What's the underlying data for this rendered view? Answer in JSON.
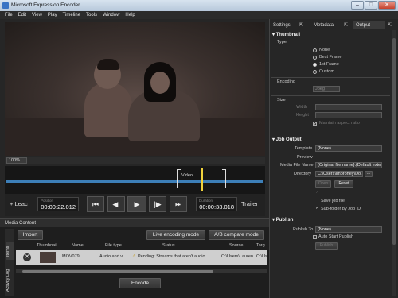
{
  "window": {
    "title": "Microsoft Expression Encoder",
    "minimize": "–",
    "maximize": "□",
    "close": "✕"
  },
  "menu": [
    "File",
    "Edit",
    "View",
    "Play",
    "Timeline",
    "Tools",
    "Window",
    "Help"
  ],
  "player": {
    "zoom": "100%",
    "lead_label": "Leac",
    "position_label": "Position",
    "position": "00:00:22.012",
    "duration_label": "Duration",
    "duration": "00:00:33.018",
    "trailer_label": "Trailer",
    "timeline_label": "Video"
  },
  "media_content": {
    "title": "Media Content",
    "import_label": "Import",
    "live_label": "Live encoding mode",
    "ab_label": "A/B compare mode",
    "side_tabs": [
      "Items",
      "Activity Log"
    ],
    "columns": [
      "Thumbnail",
      "Name",
      "File type",
      "Status",
      "Source",
      "Targ"
    ],
    "row": {
      "name": "MOV079",
      "file_type": "Audio and vi...",
      "status": "Pending: Streams that aren't audio",
      "source": "C:\\Users\\Lauren...",
      "target": "C:\\Use"
    },
    "encode_label": "Encode"
  },
  "right_panel": {
    "tabs": [
      "Settings",
      "Metadata",
      "Output"
    ],
    "thumbnail": {
      "title": "Thumbnail",
      "type_label": "Type",
      "options": [
        "None",
        "Best Frame",
        "1st Frame",
        "Custom"
      ],
      "selected": "1st Frame",
      "encoding_label": "Encoding",
      "encoding_value": "Jpeg",
      "size_label": "Size",
      "width_label": "Width",
      "height_label": "Height",
      "maintain_label": "Maintain aspect ratio"
    },
    "job_output": {
      "title": "Job Output",
      "template_label": "Template",
      "template_value": "(None)",
      "preview_label": "Preview",
      "media_file_label": "Media File Name",
      "media_file_value": "{Original file name}.{Default exten...",
      "directory_label": "Directory",
      "directory_value": "C:\\Users\\lmoroney\\Do...",
      "browse_label": "...",
      "open_label": "Open",
      "reset_label": "Reset",
      "save_job_label": "Save job file",
      "subfolder_label": "Sub-folder by Job ID"
    },
    "publish": {
      "title": "Publish",
      "publish_to_label": "Publish To",
      "publish_to_value": "(None)",
      "auto_start_label": "Auto Start Publish",
      "publish_btn_label": "Publish"
    }
  },
  "colors": {
    "accent_blue": "#3d7fb8",
    "playhead": "#f0d23c",
    "background": "#1e1e1e"
  }
}
